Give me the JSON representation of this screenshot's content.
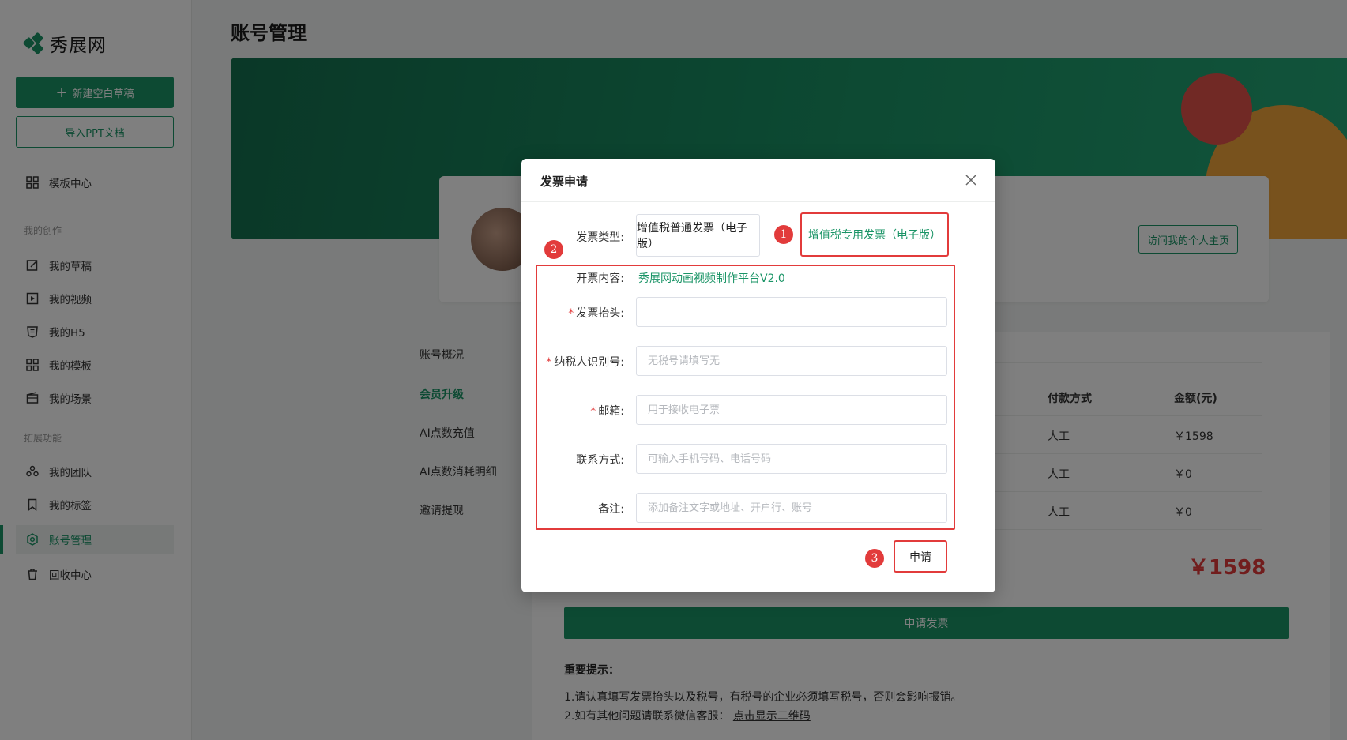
{
  "sidebar": {
    "logo_text": "秀展网",
    "new_draft_label": "新建空白草稿",
    "import_ppt_label": "导入PPT文档",
    "template_center_label": "模板中心",
    "section_my_creations": "我的创作",
    "items_creations": [
      {
        "label": "我的草稿",
        "icon": "edit-icon"
      },
      {
        "label": "我的视频",
        "icon": "play-icon"
      },
      {
        "label": "我的H5",
        "icon": "h5-icon"
      },
      {
        "label": "我的模板",
        "icon": "grid-icon"
      },
      {
        "label": "我的场景",
        "icon": "scene-icon"
      }
    ],
    "section_extensions": "拓展功能",
    "items_extensions": [
      {
        "label": "我的团队",
        "icon": "team-icon"
      },
      {
        "label": "我的标签",
        "icon": "bookmark-icon"
      },
      {
        "label": "账号管理",
        "icon": "gear-icon",
        "active": true
      },
      {
        "label": "回收中心",
        "icon": "trash-icon"
      }
    ]
  },
  "main": {
    "page_title": "账号管理",
    "visit_homepage_label": "访问我的个人主页",
    "sub_nav": [
      "账号概况",
      "会员升级",
      "AI点数充值",
      "AI点数消耗明细",
      "邀请提现"
    ],
    "table": {
      "headers": [
        "付款方式",
        "金额(元)"
      ],
      "rows": [
        {
          "payment": "人工",
          "amount": "￥1598"
        },
        {
          "payment": "人工",
          "amount": "￥0"
        },
        {
          "payment": "人工",
          "amount": "￥0"
        }
      ]
    },
    "total_amount": "￥1598",
    "apply_invoice_label": "申请发票",
    "tips_title": "重要提示：",
    "tips_line1": "1.请认真填写发票抬头以及税号，有税号的企业必须填写税号，否则会影响报销。",
    "tips_line2_prefix": "2.如有其他问题请联系微信客服：",
    "tips_line2_link": "点击显示二维码"
  },
  "modal": {
    "title": "发票申请",
    "invoice_type_label": "发票类型:",
    "invoice_type_options": [
      "增值税普通发票（电子版）",
      "增值税专用发票（电子版）"
    ],
    "invoice_type_selected": "增值税专用发票（电子版）",
    "content_label": "开票内容:",
    "content_value": "秀展网动画视频制作平台V2.0",
    "title_label": "发票抬头:",
    "title_value": "",
    "tax_id_label": "纳税人识别号:",
    "tax_id_placeholder": "无税号请填写无",
    "email_label": "邮箱:",
    "email_placeholder": "用于接收电子票",
    "contact_label": "联系方式:",
    "contact_placeholder": "可输入手机号码、电话号码",
    "remark_label": "备注:",
    "remark_placeholder": "添加备注文字或地址、开户行、账号",
    "submit_label": "申请",
    "required_mark": "*"
  },
  "annotations": {
    "step1": "1",
    "step2": "2",
    "step3": "3",
    "color": "#e23b3b"
  },
  "colors": {
    "brand": "#1a9466",
    "price": "#e23b3b"
  }
}
